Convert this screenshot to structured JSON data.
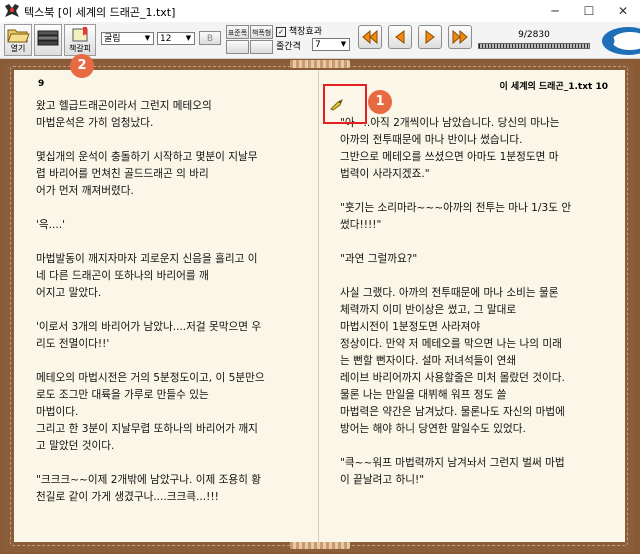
{
  "window": {
    "app_name": "텍스북",
    "title": "텍스북 [이 세계의 드래곤_1.txt]",
    "minimize": "─",
    "maximize": "☐",
    "close": "✕"
  },
  "toolbar": {
    "open_label": "열기",
    "bookmark_label": "책갈피",
    "font_name": "굴림",
    "font_size": "12",
    "bold_label": "B",
    "btn_small_1": "표준폭",
    "btn_small_2": "책폭형",
    "effect_label": "책장효과",
    "line_spacing_label": "줄간격",
    "line_spacing_value": "7",
    "page_counter": "9/2830",
    "progress_percent": 0.3
  },
  "book": {
    "left_page_number": "9",
    "right_header": "이 세계의 드래곤_1.txt 10",
    "left_text": "왔고 헬급드래곤이라서 그런지 메테오의\n마법운석은 가히 엄청났다.\n\n몇십개의 운석이 충돌하기 시작하고 몇분이 지날무\n렵 바리어를 먼쳐친 골드드래곤 의 바리\n어가 먼저 깨져버렸다.\n\n'윽....'\n\n마법발동이 깨지자마자 괴로운지 신음을 흘리고 이\n네 다른 드래곤이 또하나의 바리어를 깨\n어지고 말았다.\n\n'이로서 3개의 바리어가 남았나....저걸 못막으면 우\n리도 전멸이다!!'\n\n메테오의 마법시전은 거의 5분정도이고, 이 5분만으\n로도 조그만 대륙을 가루로 만들수 있는\n마법이다.\n그리고 한 3분이 지날무렵 또하나의 바리어가 깨지\n고 말았던 것이다.\n\n\"크크크~~이제 2개밖에 남았구나. 이제 조용히 황\n천길로 같이 가게 생겼구나....크크큭...!!!",
    "right_text": "\"아~..아직 2개씩이나 남았습니다. 당신의 마나는\n아까의 전투때문에 마나 반이나 썼습니다.\n그반으로 메테오를 쓰셨으면 아마도 1분정도면 마\n법력이 사라지겠죠.\"\n\n\"훗기는 소리마라~~~아까의 전투는 마나 1/3도 안\n썼다!!!!\"\n\n\"과연 그럴까요?\"\n\n사실 그랬다. 아까의 전투때문에 마나 소비는 물론\n체력까지 이미 반이상은 썼고, 그 말대로\n마법시전이 1분정도면 사라져야\n정상이다. 만약 저 메테오를 막으면 나는 나의 미래\n는 뻔할 뻔자이다. 설마 저녀석들이 연쇄\n레이브 바리어까지 사용할줄은 미처 몰랐던 것이다.\n물론 나는 만일을 대뷔해 워프 정도 쓸\n마법력은 약간은 남겨났다. 물론나도 자신의 마법에\n방어는 해야 하니 당연한 말일수도 있었다.\n\n\"큭~~워프 마법력까지 남겨놔서 그런지 벌써 마법\n이 끝날려고 하니!\""
  },
  "annotations": {
    "badge_1": "1",
    "badge_2": "2"
  },
  "colors": {
    "badge": "#e86a42",
    "highlight": "#e52020",
    "page": "#fbf7e8",
    "cover": "#8b5e3b"
  }
}
